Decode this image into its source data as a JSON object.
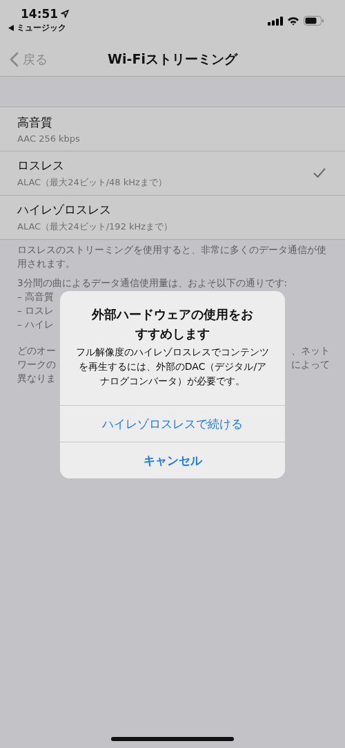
{
  "status_bar": {
    "time": "14:51",
    "back_app": "ミュージック"
  },
  "nav": {
    "back": "戻る",
    "title": "Wi-Fiストリーミング"
  },
  "options": [
    {
      "label": "高音質",
      "detail": "AAC 256 kbps",
      "selected": false
    },
    {
      "label": "ロスレス",
      "detail": "ALAC（最大24ビット/48 kHzまで）",
      "selected": true
    },
    {
      "label": "ハイレゾロスレス",
      "detail": "ALAC（最大24ビット/192 kHzまで）",
      "selected": false
    }
  ],
  "footer": {
    "intro": "ロスレスのストリーミングを使用すると、非常に多くのデータ通信が使用されます。",
    "usage_heading": "3分間の曲によるデータ通信使用量は、およそ以下の通りです:",
    "usage_items": [
      "– 高音質",
      "– ロスレ",
      "– ハイレ"
    ],
    "note_lines": [
      {
        "left": "どのオー",
        "right": "、ネット"
      },
      {
        "left": "ワークの",
        "right": "によって"
      },
      {
        "left": "異なりま"
      }
    ]
  },
  "alert": {
    "title": "外部ハードウェアの使用をおすすめします",
    "message": "フル解像度のハイレゾロスレスでコンテンツを再生するには、外部のDAC（デジタル/アナログコンバータ）が必要です。",
    "actions": [
      {
        "label": "ハイレゾロスレスで続ける",
        "kind": "default"
      },
      {
        "label": "キャンセル",
        "kind": "preferred"
      }
    ]
  }
}
